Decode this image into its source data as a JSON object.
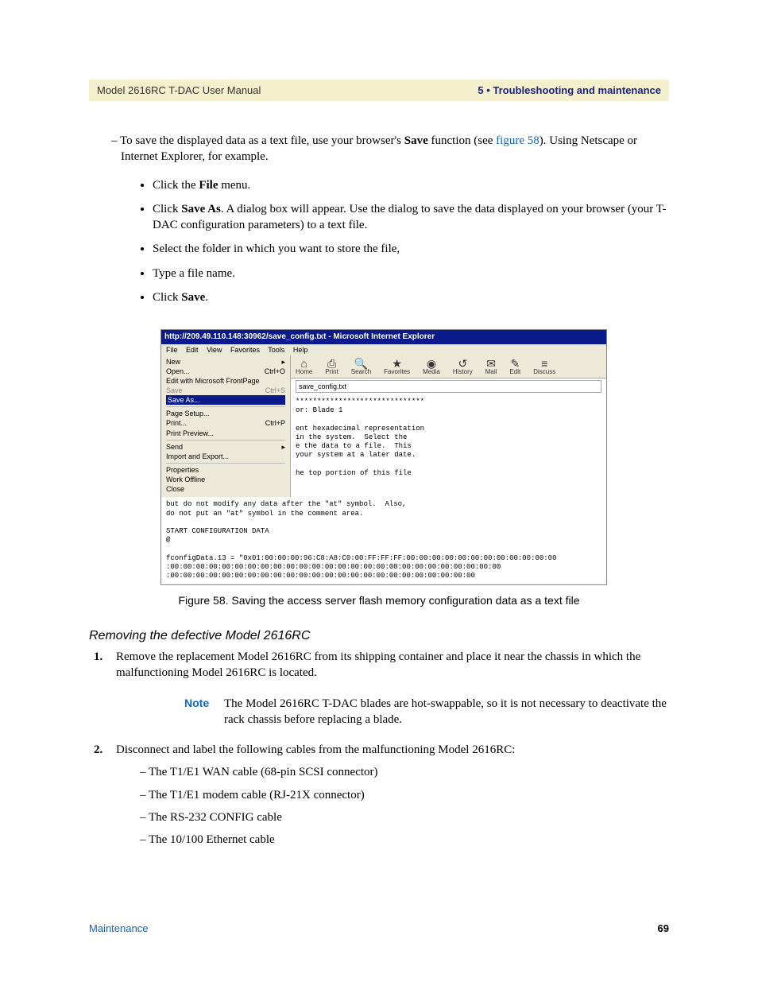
{
  "header": {
    "left": "Model 2616RC T-DAC User Manual",
    "right": "5 • Troubleshooting and maintenance"
  },
  "intro": {
    "dash1_pre": "– To save the displayed data as a text file, use your browser's ",
    "save_bold": "Save",
    "dash1_mid": " function (see ",
    "figref": "figure 58",
    "dash1_post": "). Using Netscape or Internet Explorer, for example."
  },
  "bullets": {
    "b1_pre": "Click the ",
    "b1_bold": "File",
    "b1_post": " menu.",
    "b2_pre": "Click ",
    "b2_bold": "Save As",
    "b2_post": ". A dialog box will appear. Use the dialog to save the data displayed on your browser (your T-DAC configuration parameters) to a text file.",
    "b3": "Select the folder in which you want to store the file,",
    "b4": "Type a file name.",
    "b5_pre": "Click ",
    "b5_bold": "Save",
    "b5_post": "."
  },
  "ie": {
    "title": "http://209.49.110.148:30962/save_config.txt - Microsoft Internet Explorer",
    "menu": [
      "File",
      "Edit",
      "View",
      "Favorites",
      "Tools",
      "Help"
    ],
    "filemenu": {
      "new": "New",
      "new_arrow": "▸",
      "open": "Open...",
      "open_sc": "Ctrl+O",
      "editwith": "Edit with Microsoft FrontPage",
      "save": "Save",
      "save_sc": "Ctrl+S",
      "saveas": "Save As...",
      "page_setup": "Page Setup...",
      "print": "Print...",
      "print_sc": "Ctrl+P",
      "print_preview": "Print Preview...",
      "send": "Send",
      "send_arrow": "▸",
      "import": "Import and Export...",
      "properties": "Properties",
      "work_offline": "Work Offline",
      "close": "Close"
    },
    "toolbar": [
      {
        "glyph": "⌂",
        "label": "Home"
      },
      {
        "glyph": "⎙",
        "label": "Print"
      },
      {
        "glyph": "🔍",
        "label": "Search"
      },
      {
        "glyph": "★",
        "label": "Favorites"
      },
      {
        "glyph": "◉",
        "label": "Media"
      },
      {
        "glyph": "↺",
        "label": "History"
      },
      {
        "glyph": "✉",
        "label": "Mail"
      },
      {
        "glyph": "✎",
        "label": "Edit"
      },
      {
        "glyph": "≡",
        "label": "Discuss"
      }
    ],
    "address": "save_config.txt",
    "body_lines": [
      "******************************",
      "or: Blade 1",
      "",
      "ent hexadecimal representation",
      "in the system.  Select the",
      "e the data to a file.  This",
      "your system at a later date.",
      "",
      "he top portion of this file"
    ],
    "body_full": [
      "but do not modify any data after the \"at\" symbol.  Also,",
      "do not put an \"at\" symbol in the comment area.",
      "",
      "START CONFIGURATION DATA",
      "@",
      "",
      "fconfigData.13 = \"0x01:00:00:00:96:C8:A8:C0:00:FF:FF:FF:00:00:00:00:00:00:00:00:00:00:00:00",
      ":00:00:00:00:00:00:00:00:00:00:00:00:00:00:00:00:00:00:00:00:00:00:00:00:00:00",
      ":00:00:00:00:00:00:00:00:00:00:00:00:00:00:00:00:00:00:00:00:00:00:00:00"
    ]
  },
  "caption": "Figure 58. Saving the access server flash memory configuration data as a text file",
  "subhead": "Removing the defective Model 2616RC",
  "step1": {
    "num": "1.",
    "text": "Remove the replacement Model 2616RC from its shipping container and place it near the chassis in which the malfunctioning Model 2616RC is located."
  },
  "note": {
    "label": "Note",
    "text": "The Model 2616RC T-DAC blades are hot-swappable, so it is not necessary to deactivate the rack chassis before replacing a blade."
  },
  "step2": {
    "num": "2.",
    "text": "Disconnect and label the following cables from the malfunctioning Model 2616RC:",
    "items": [
      "– The T1/E1 WAN cable (68-pin SCSI connector)",
      "– The T1/E1 modem cable (RJ-21X connector)",
      "– The RS-232 CONFIG cable",
      "– The 10/100 Ethernet cable"
    ]
  },
  "footer": {
    "left": "Maintenance",
    "right": "69"
  }
}
